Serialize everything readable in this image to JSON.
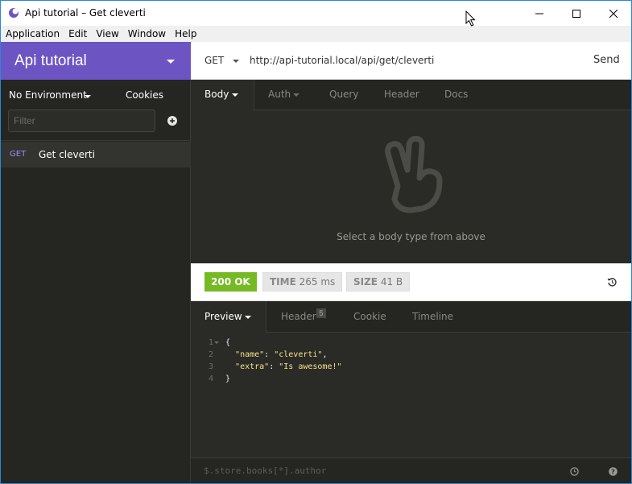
{
  "window": {
    "title": "Api tutorial – Get cleverti"
  },
  "menubar": {
    "items": [
      "Application",
      "Edit",
      "View",
      "Window",
      "Help"
    ]
  },
  "sidebar": {
    "workspace_title": "Api tutorial",
    "environment": "No Environment",
    "cookies_label": "Cookies",
    "filter_placeholder": "Filter",
    "requests": [
      {
        "method": "GET",
        "name": "Get cleverti"
      }
    ]
  },
  "urlbar": {
    "method": "GET",
    "url": "http://api-tutorial.local/api/get/cleverti",
    "send_label": "Send"
  },
  "request_tabs": {
    "body": "Body",
    "auth": "Auth",
    "query": "Query",
    "header": "Header",
    "docs": "Docs"
  },
  "request_body": {
    "empty_message": "Select a body type from above",
    "icon": "peace-hand-icon"
  },
  "response_meta": {
    "status": "200 OK",
    "time_label": "TIME",
    "time_value": "265 ms",
    "size_label": "SIZE",
    "size_value": "41 B"
  },
  "response_tabs": {
    "preview": "Preview",
    "header": "Header",
    "header_count": "5",
    "cookie": "Cookie",
    "timeline": "Timeline"
  },
  "response_body": {
    "line_numbers": [
      "1",
      "2",
      "3",
      "4"
    ],
    "open_brace": "{",
    "close_brace": "}",
    "key1": "\"name\"",
    "val1": "\"cleverti\"",
    "key2": "\"extra\"",
    "val2": "\"Is awesome!\""
  },
  "response_filter": {
    "placeholder": "$.store.books[*].author"
  },
  "colors": {
    "accent": "#6c55c3",
    "status_ok": "#75ba24",
    "method_get": "#a18df5",
    "dark_bg": "#2a2a26"
  }
}
